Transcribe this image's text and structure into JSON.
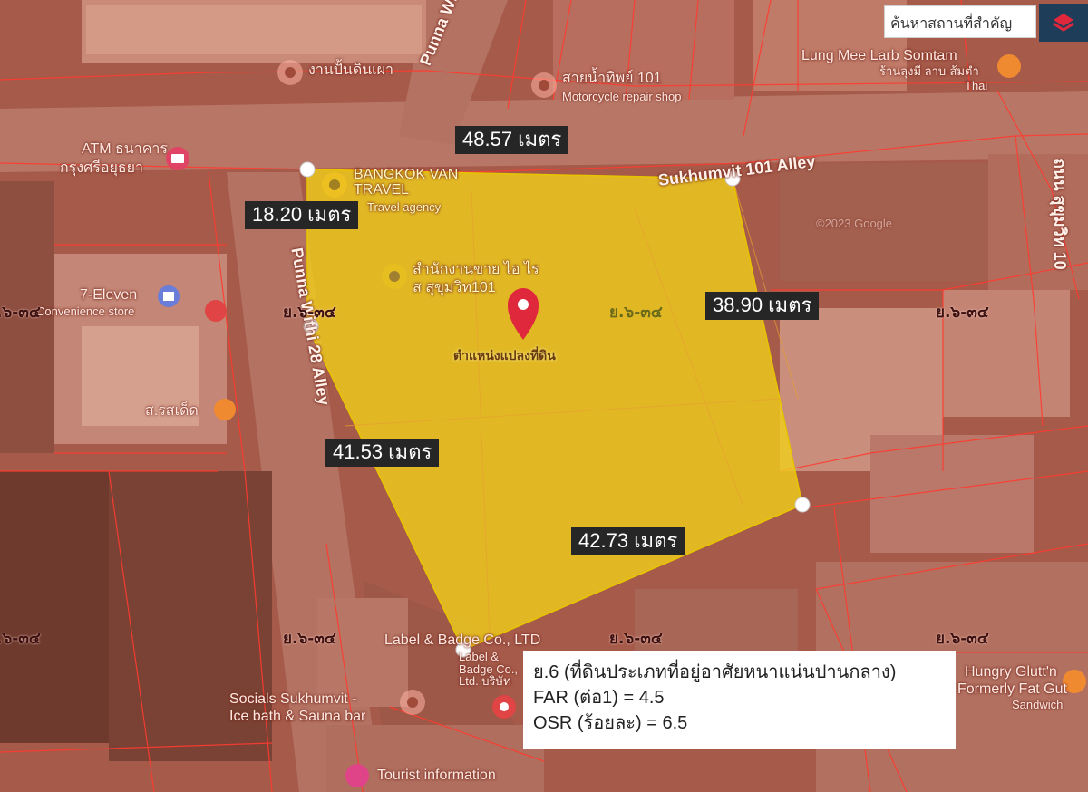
{
  "search": {
    "placeholder": "ค้นหาสถานที่สำคัญ"
  },
  "layers_button": {
    "icon": "layers-icon",
    "color": "#1d3d58",
    "icon_color": "#e0283c"
  },
  "pin": {
    "label": "ตำแหน่งแปลงที่ดิน",
    "color": "#e0283c"
  },
  "parcel": {
    "fill_color": "#f2d21a"
  },
  "measurements": [
    "48.57 เมตร",
    "18.20 เมตร",
    "38.90 เมตร",
    "41.53 เมตร",
    "42.73 เมตร"
  ],
  "zone_code": "ย.๖-๓๔",
  "map_labels": {
    "ban_pan_din_phao": "งานปั้นดินเผา",
    "punna_withi_street": "Punna Withi",
    "sai_nam_thip": "สายน้ำทิพย์ 101",
    "motorcycle_repair": "Motorcycle repair shop",
    "lung_mee_larb": "Lung Mee Larb Somtam",
    "lung_mee_thai": "ร้านลุงมี ลาบ-ส้มตำ",
    "thai": "Thai",
    "atm_bank": "ATM ธนาคาร",
    "krungsri": "กรุงศรีอยุธยา",
    "bangkok_van_travel": "BANGKOK VAN TRAVEL",
    "travel_agency": "Travel agency",
    "sukhumvit_101_alley": "Sukhumvit 101 Alley",
    "thanon_sukhumvit": "ถนน สุขุมวิท 10",
    "sales_office_line1": "สำนักงานขาย ไอ ไร",
    "sales_office_line2": "ส สุขุมวิท101",
    "seven_eleven": "7-Eleven",
    "convenience_store": "Convenience store",
    "punna_withi_28_alley": "Punna Withi 28 Alley",
    "sor_rot_det": "ส.รสเด็ด",
    "label_badge": "Label & Badge Co., LTD",
    "label_badge_sub": "Label & Badge Co., Ltd. บริษัท",
    "hungry_glutton": "Hungry Glutt'n",
    "formerly_fat_gut": "Formerly Fat Gut",
    "sandwich": "Sandwich",
    "socials_sukhumvit": "Socials Sukhumvit -",
    "ice_bath": "Ice bath & Sauna bar",
    "tourist_information": "Tourist information",
    "google_attrib": "©2023 Google"
  },
  "info_panel": {
    "zoning": "ย.6 (ที่ดินประเภทที่อยู่อาศัยหนาแน่นปานกลาง)",
    "far": "FAR (ต่อ1) = 4.5",
    "osr": "OSR (ร้อยละ) = 6.5"
  }
}
